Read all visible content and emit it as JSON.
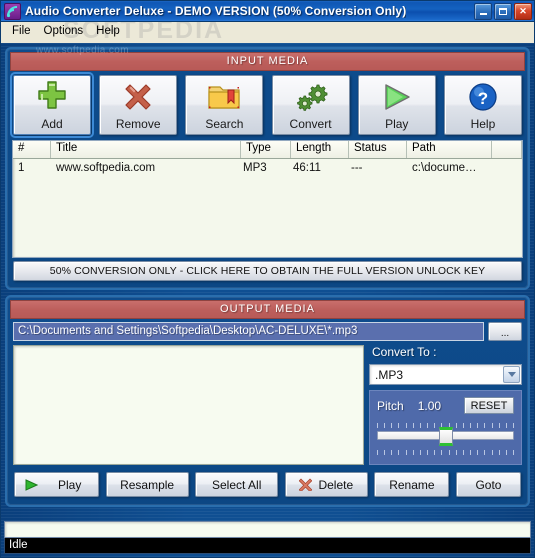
{
  "window": {
    "title": "Audio Converter Deluxe - DEMO VERSION (50% Conversion Only)",
    "app_icon": "audio-wave-icon",
    "controls": {
      "minimize": "minimize-icon",
      "maximize": "maximize-icon",
      "close": "close-icon"
    }
  },
  "menubar": {
    "items": [
      {
        "label": "File"
      },
      {
        "label": "Options"
      },
      {
        "label": "Help"
      }
    ],
    "watermark": "SOFTPEDIA"
  },
  "watermarks": {
    "url": "www.softpedia.com"
  },
  "input_media": {
    "section_title": "INPUT MEDIA",
    "toolbar": [
      {
        "label": "Add",
        "icon": "plus-icon",
        "focused": true
      },
      {
        "label": "Remove",
        "icon": "x-cross-icon",
        "focused": false
      },
      {
        "label": "Search",
        "icon": "folder-search-icon",
        "focused": false
      },
      {
        "label": "Convert",
        "icon": "gears-icon",
        "focused": false
      },
      {
        "label": "Play",
        "icon": "play-triangle-icon",
        "focused": false
      },
      {
        "label": "Help",
        "icon": "question-mark-icon",
        "focused": false
      }
    ],
    "columns": [
      "#",
      "Title",
      "Type",
      "Length",
      "Status",
      "Path"
    ],
    "rows": [
      {
        "num": "1",
        "title": "www.softpedia.com",
        "type": "MP3",
        "length": "46:11",
        "status": "---",
        "path": "c:\\docume…"
      }
    ]
  },
  "unlock_banner": {
    "label": "50% CONVERSION ONLY - CLICK HERE TO OBTAIN THE FULL VERSION UNLOCK KEY"
  },
  "output_media": {
    "section_title": "OUTPUT MEDIA",
    "path_value": "C:\\Documents and Settings\\Softpedia\\Desktop\\AC-DELUXE\\*.mp3",
    "browse_label": "...",
    "convert_to": {
      "label": "Convert To :",
      "selected": ".MP3",
      "arrow_icon": "chevron-down-icon"
    },
    "pitch": {
      "label": "Pitch",
      "value": "1.00",
      "reset_label": "RESET",
      "slider_position_percent": 50
    }
  },
  "bottom_buttons": [
    {
      "label": "Play",
      "icon": "play-triangle-icon"
    },
    {
      "label": "Resample",
      "icon": ""
    },
    {
      "label": "Select All",
      "icon": ""
    },
    {
      "label": "Delete",
      "icon": "x-cross-icon"
    },
    {
      "label": "Rename",
      "icon": ""
    },
    {
      "label": "Goto",
      "icon": ""
    }
  ],
  "status": {
    "progress_percent": 0,
    "text": "Idle"
  },
  "colors": {
    "title_bar": "#1462c0",
    "section_bar": "#bd5f5c",
    "window_bg": "#0f4f92",
    "list_bg": "#f4f8ec",
    "path_field_bg": "#5a6fae",
    "pitch_panel_bg": "#4f6aaa",
    "status_bg": "#000000",
    "accent_green": "#2ec033"
  }
}
